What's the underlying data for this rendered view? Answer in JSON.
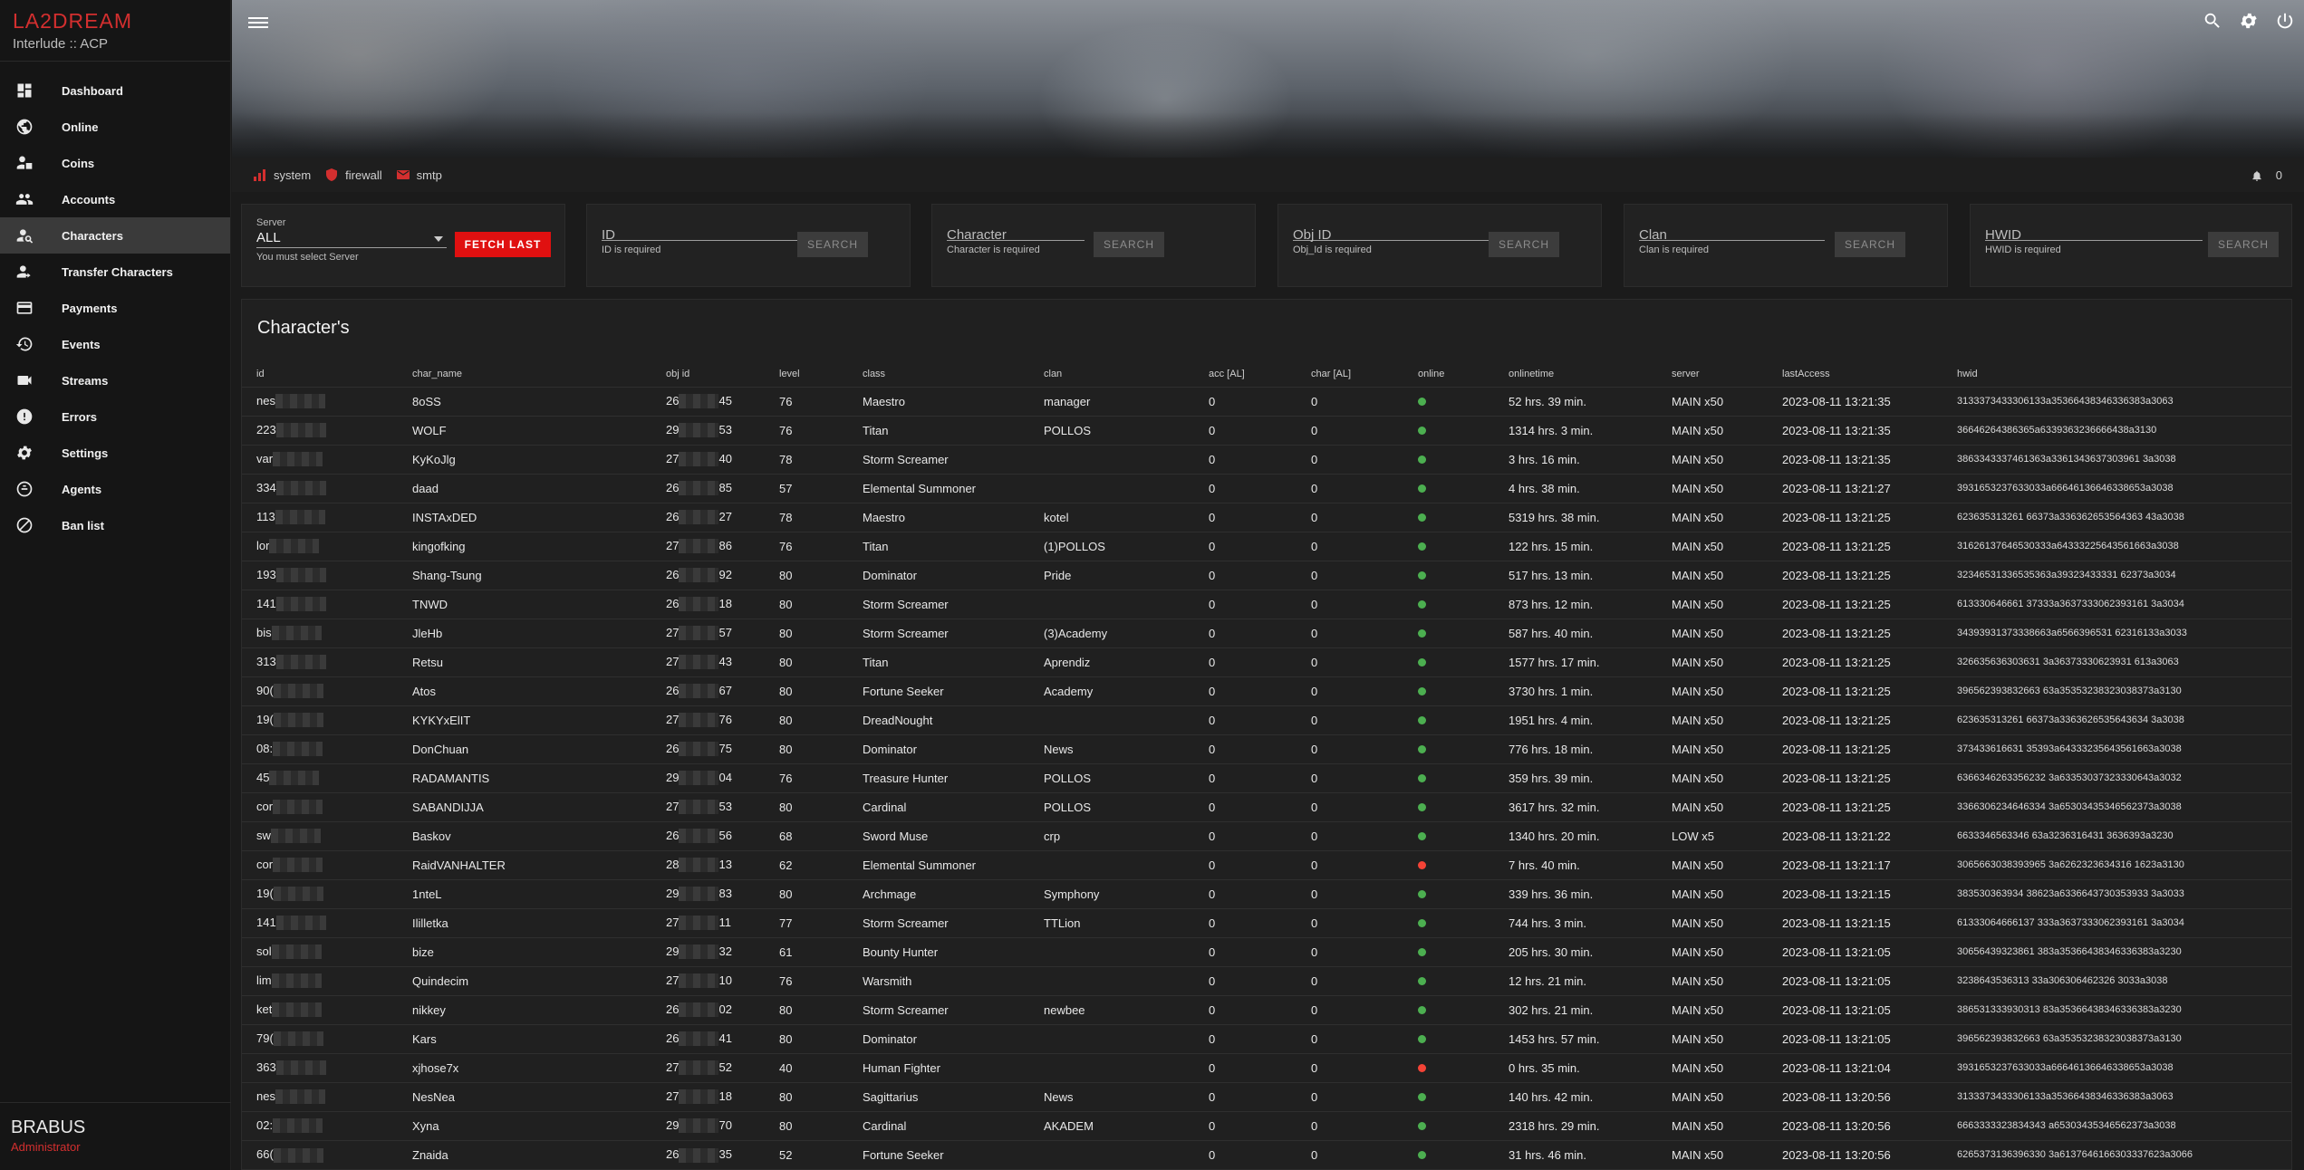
{
  "brand": {
    "title": "LA2DREAM",
    "subtitle": "Interlude :: ACP"
  },
  "sidebar": {
    "items": [
      {
        "label": "Dashboard",
        "icon": "dashboard-icon"
      },
      {
        "label": "Online",
        "icon": "globe-icon"
      },
      {
        "label": "Coins",
        "icon": "coins-icon"
      },
      {
        "label": "Accounts",
        "icon": "people-icon"
      },
      {
        "label": "Characters",
        "icon": "person-search-icon",
        "active": true
      },
      {
        "label": "Transfer Characters",
        "icon": "person-transfer-icon"
      },
      {
        "label": "Payments",
        "icon": "credit-card-icon"
      },
      {
        "label": "Events",
        "icon": "history-icon"
      },
      {
        "label": "Streams",
        "icon": "video-icon"
      },
      {
        "label": "Errors",
        "icon": "error-icon"
      },
      {
        "label": "Settings",
        "icon": "gear-icon"
      },
      {
        "label": "Agents",
        "icon": "agent-icon"
      },
      {
        "label": "Ban list",
        "icon": "ban-icon"
      }
    ]
  },
  "user": {
    "name": "BRABUS",
    "role": "Administrator"
  },
  "status": {
    "items": [
      {
        "label": "system",
        "color": "#d32f2f"
      },
      {
        "label": "firewall",
        "color": "#d32f2f"
      },
      {
        "label": "smtp",
        "color": "#d32f2f"
      }
    ],
    "notifications": "0"
  },
  "filters": {
    "server": {
      "label": "Server",
      "value": "ALL",
      "hint": "You must select Server",
      "button": "FETCH LAST"
    },
    "id": {
      "placeholder": "ID",
      "hint": "ID is required",
      "button": "SEARCH"
    },
    "character": {
      "placeholder": "Character",
      "hint": "Character is required",
      "button": "SEARCH"
    },
    "obj_id": {
      "placeholder": "Obj ID",
      "hint": "Obj_Id is required",
      "button": "SEARCH"
    },
    "clan": {
      "placeholder": "Clan",
      "hint": "Clan is required",
      "button": "SEARCH"
    },
    "hwid": {
      "placeholder": "HWID",
      "hint": "HWID is required",
      "button": "SEARCH"
    }
  },
  "table": {
    "title": "Character's",
    "columns": [
      "id",
      "char_name",
      "obj id",
      "level",
      "class",
      "clan",
      "acc [AL]",
      "char [AL]",
      "online",
      "onlinetime",
      "server",
      "lastAccess",
      "hwid"
    ],
    "rows": [
      {
        "id": "nes",
        "char_name": "8oSS",
        "obj_a": "26",
        "obj_b": "45",
        "level": "76",
        "class": "Maestro",
        "clan": "manager",
        "acc": "0",
        "char": "0",
        "online": "green",
        "onlinetime": "52 hrs. 39 min.",
        "server": "MAIN x50",
        "last": "2023-08-11 13:21:35",
        "hwid": "3133373433306133a35366438346336383a3063"
      },
      {
        "id": "223",
        "char_name": "WOLF",
        "obj_a": "29",
        "obj_b": "53",
        "level": "76",
        "class": "Titan",
        "clan": "POLLOS",
        "acc": "0",
        "char": "0",
        "online": "green",
        "onlinetime": "1314 hrs. 3 min.",
        "server": "MAIN x50",
        "last": "2023-08-11 13:21:35",
        "hwid": "36646264386365a6339363236666438a3130"
      },
      {
        "id": "var",
        "char_name": "KyKoJlg",
        "obj_a": "27",
        "obj_b": "40",
        "level": "78",
        "class": "Storm Screamer",
        "clan": "",
        "acc": "0",
        "char": "0",
        "online": "green",
        "onlinetime": "3 hrs. 16 min.",
        "server": "MAIN x50",
        "last": "2023-08-11 13:21:35",
        "hwid": "3863343337461363a3361343637303961 3a3038"
      },
      {
        "id": "334",
        "char_name": "daad",
        "obj_a": "26",
        "obj_b": "85",
        "level": "57",
        "class": "Elemental Summoner",
        "clan": "",
        "acc": "0",
        "char": "0",
        "online": "green",
        "onlinetime": "4 hrs. 38 min.",
        "server": "MAIN x50",
        "last": "2023-08-11 13:21:27",
        "hwid": "3931653237633033a66646136646338653a3038"
      },
      {
        "id": "113",
        "char_name": "INSTAxDED",
        "obj_a": "26",
        "obj_b": "27",
        "level": "78",
        "class": "Maestro",
        "clan": "kotel",
        "acc": "0",
        "char": "0",
        "online": "green",
        "onlinetime": "5319 hrs. 38 min.",
        "server": "MAIN x50",
        "last": "2023-08-11 13:21:25",
        "hwid": "623635313261 66373a336362653564363 43a3038"
      },
      {
        "id": "lor",
        "char_name": "kingofking",
        "obj_a": "27",
        "obj_b": "86",
        "level": "76",
        "class": "Titan",
        "clan": "(1)POLLOS",
        "acc": "0",
        "char": "0",
        "online": "green",
        "onlinetime": "122 hrs. 15 min.",
        "server": "MAIN x50",
        "last": "2023-08-11 13:21:25",
        "hwid": "31626137646530333a64333225643561663a3038"
      },
      {
        "id": "193",
        "char_name": "Shang-Tsung",
        "obj_a": "26",
        "obj_b": "92",
        "level": "80",
        "class": "Dominator",
        "clan": "Pride",
        "acc": "0",
        "char": "0",
        "online": "green",
        "onlinetime": "517 hrs. 13 min.",
        "server": "MAIN x50",
        "last": "2023-08-11 13:21:25",
        "hwid": "32346531336535363a39323433331 62373a3034"
      },
      {
        "id": "141",
        "char_name": "TNWD",
        "obj_a": "26",
        "obj_b": "18",
        "level": "80",
        "class": "Storm Screamer",
        "clan": "",
        "acc": "0",
        "char": "0",
        "online": "green",
        "onlinetime": "873 hrs. 12 min.",
        "server": "MAIN x50",
        "last": "2023-08-11 13:21:25",
        "hwid": "613330646661 37333a3637333062393161 3a3034"
      },
      {
        "id": "bis",
        "char_name": "JleHb",
        "obj_a": "27",
        "obj_b": "57",
        "level": "80",
        "class": "Storm Screamer",
        "clan": "(3)Academy",
        "acc": "0",
        "char": "0",
        "online": "green",
        "onlinetime": "587 hrs. 40 min.",
        "server": "MAIN x50",
        "last": "2023-08-11 13:21:25",
        "hwid": "34393931373338663a6566396531 62316133a3033"
      },
      {
        "id": "313",
        "char_name": "Retsu",
        "obj_a": "27",
        "obj_b": "43",
        "level": "80",
        "class": "Titan",
        "clan": "Aprendiz",
        "acc": "0",
        "char": "0",
        "online": "green",
        "onlinetime": "1577 hrs. 17 min.",
        "server": "MAIN x50",
        "last": "2023-08-11 13:21:25",
        "hwid": "326635636303631 3a36373330623931 613a3063"
      },
      {
        "id": "90(",
        "char_name": "Atos",
        "obj_a": "26",
        "obj_b": "67",
        "level": "80",
        "class": "Fortune Seeker",
        "clan": "Academy",
        "acc": "0",
        "char": "0",
        "online": "green",
        "onlinetime": "3730 hrs. 1 min.",
        "server": "MAIN x50",
        "last": "2023-08-11 13:21:25",
        "hwid": "396562393832663 63a35353238323038373a3130"
      },
      {
        "id": "19(",
        "char_name": "KYKYxElIT",
        "obj_a": "27",
        "obj_b": "76",
        "level": "80",
        "class": "DreadNought",
        "clan": "",
        "acc": "0",
        "char": "0",
        "online": "green",
        "onlinetime": "1951 hrs. 4 min.",
        "server": "MAIN x50",
        "last": "2023-08-11 13:21:25",
        "hwid": "623635313261 66373a3363626535643634 3a3038"
      },
      {
        "id": "08:",
        "char_name": "DonChuan",
        "obj_a": "26",
        "obj_b": "75",
        "level": "80",
        "class": "Dominator",
        "clan": "News",
        "acc": "0",
        "char": "0",
        "online": "green",
        "onlinetime": "776 hrs. 18 min.",
        "server": "MAIN x50",
        "last": "2023-08-11 13:21:25",
        "hwid": "373433616631 35393a64333235643561663a3038"
      },
      {
        "id": "45",
        "char_name": "RADAMANTIS",
        "obj_a": "29",
        "obj_b": "04",
        "level": "76",
        "class": "Treasure Hunter",
        "clan": "POLLOS",
        "acc": "0",
        "char": "0",
        "online": "green",
        "onlinetime": "359 hrs. 39 min.",
        "server": "MAIN x50",
        "last": "2023-08-11 13:21:25",
        "hwid": "6366346263356232 3a63353037323330643a3032"
      },
      {
        "id": "cor",
        "char_name": "SABANDIJJA",
        "obj_a": "27",
        "obj_b": "53",
        "level": "80",
        "class": "Cardinal",
        "clan": "POLLOS",
        "acc": "0",
        "char": "0",
        "online": "green",
        "onlinetime": "3617 hrs. 32 min.",
        "server": "MAIN x50",
        "last": "2023-08-11 13:21:25",
        "hwid": "3366306234646334 3a65303435346562373a3038"
      },
      {
        "id": "sw",
        "char_name": "Baskov",
        "obj_a": "26",
        "obj_b": "56",
        "level": "68",
        "class": "Sword Muse",
        "clan": "crp",
        "acc": "0",
        "char": "0",
        "online": "green",
        "onlinetime": "1340 hrs. 20 min.",
        "server": "LOW x5",
        "last": "2023-08-11 13:21:22",
        "hwid": "6633346563346 63a3236316431 3636393a3230"
      },
      {
        "id": "cor",
        "char_name": "RaidVANHALTER",
        "obj_a": "28",
        "obj_b": "13",
        "level": "62",
        "class": "Elemental Summoner",
        "clan": "",
        "acc": "0",
        "char": "0",
        "online": "red",
        "onlinetime": "7 hrs. 40 min.",
        "server": "MAIN x50",
        "last": "2023-08-11 13:21:17",
        "hwid": "3065663038393965 3a6262323634316 1623a3130"
      },
      {
        "id": "19(",
        "char_name": "1nteL",
        "obj_a": "29",
        "obj_b": "83",
        "level": "80",
        "class": "Archmage",
        "clan": "Symphony",
        "acc": "0",
        "char": "0",
        "online": "green",
        "onlinetime": "339 hrs. 36 min.",
        "server": "MAIN x50",
        "last": "2023-08-11 13:21:15",
        "hwid": "383530363934 38623a6336643730353933 3a3033"
      },
      {
        "id": "141",
        "char_name": "Ililletka",
        "obj_a": "27",
        "obj_b": "11",
        "level": "77",
        "class": "Storm Screamer",
        "clan": "TTLion",
        "acc": "0",
        "char": "0",
        "online": "green",
        "onlinetime": "744 hrs. 3 min.",
        "server": "MAIN x50",
        "last": "2023-08-11 13:21:15",
        "hwid": "61333064666137 333a3637333062393161 3a3034"
      },
      {
        "id": "sol",
        "char_name": "bize",
        "obj_a": "29",
        "obj_b": "32",
        "level": "61",
        "class": "Bounty Hunter",
        "clan": "",
        "acc": "0",
        "char": "0",
        "online": "green",
        "onlinetime": "205 hrs. 30 min.",
        "server": "MAIN x50",
        "last": "2023-08-11 13:21:05",
        "hwid": "30656439323861 383a35366438346336383a3230"
      },
      {
        "id": "lim",
        "char_name": "Quindecim",
        "obj_a": "27",
        "obj_b": "10",
        "level": "76",
        "class": "Warsmith",
        "clan": "",
        "acc": "0",
        "char": "0",
        "online": "green",
        "onlinetime": "12 hrs. 21 min.",
        "server": "MAIN x50",
        "last": "2023-08-11 13:21:05",
        "hwid": "3238643536313 33a306306462326 3033a3038"
      },
      {
        "id": "ket",
        "char_name": "nikkey",
        "obj_a": "26",
        "obj_b": "02",
        "level": "80",
        "class": "Storm Screamer",
        "clan": "newbee",
        "acc": "0",
        "char": "0",
        "online": "green",
        "onlinetime": "302 hrs. 21 min.",
        "server": "MAIN x50",
        "last": "2023-08-11 13:21:05",
        "hwid": "386531333930313 83a35366438346336383a3230"
      },
      {
        "id": "79(",
        "char_name": "Kars",
        "obj_a": "26",
        "obj_b": "41",
        "level": "80",
        "class": "Dominator",
        "clan": "",
        "acc": "0",
        "char": "0",
        "online": "green",
        "onlinetime": "1453 hrs. 57 min.",
        "server": "MAIN x50",
        "last": "2023-08-11 13:21:05",
        "hwid": "396562393832663 63a35353238323038373a3130"
      },
      {
        "id": "363",
        "char_name": "xjhose7x",
        "obj_a": "27",
        "obj_b": "52",
        "level": "40",
        "class": "Human Fighter",
        "clan": "",
        "acc": "0",
        "char": "0",
        "online": "red",
        "onlinetime": "0 hrs. 35 min.",
        "server": "MAIN x50",
        "last": "2023-08-11 13:21:04",
        "hwid": "3931653237633033a66646136646338653a3038"
      },
      {
        "id": "nes",
        "char_name": "NesNea",
        "obj_a": "27",
        "obj_b": "18",
        "level": "80",
        "class": "Sagittarius",
        "clan": "News",
        "acc": "0",
        "char": "0",
        "online": "green",
        "onlinetime": "140 hrs. 42 min.",
        "server": "MAIN x50",
        "last": "2023-08-11 13:20:56",
        "hwid": "3133373433306133a35366438346336383a3063"
      },
      {
        "id": "02:",
        "char_name": "Xyna",
        "obj_a": "29",
        "obj_b": "70",
        "level": "80",
        "class": "Cardinal",
        "clan": "AKADEM",
        "acc": "0",
        "char": "0",
        "online": "green",
        "onlinetime": "2318 hrs. 29 min.",
        "server": "MAIN x50",
        "last": "2023-08-11 13:20:56",
        "hwid": "6663333323834343 a65303435346562373a3038"
      },
      {
        "id": "66(",
        "char_name": "Znaida",
        "obj_a": "26",
        "obj_b": "35",
        "level": "52",
        "class": "Fortune Seeker",
        "clan": "",
        "acc": "0",
        "char": "0",
        "online": "green",
        "onlinetime": "31 hrs. 46 min.",
        "server": "MAIN x50",
        "last": "2023-08-11 13:20:56",
        "hwid": "6265373136396330 3a6137646166303337623a3066"
      }
    ]
  },
  "colors": {
    "accent": "#e01010",
    "online_green": "#4caf50",
    "offline_red": "#f44336"
  }
}
